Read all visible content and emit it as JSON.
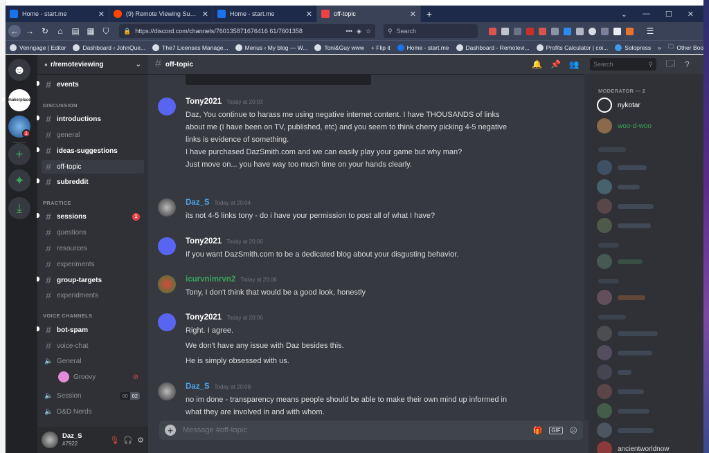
{
  "browser": {
    "tabs": [
      {
        "title": "Home - start.me",
        "favicon_color": "#1a73e8",
        "active": false
      },
      {
        "title": "(9) Remote Viewing Subreddit",
        "favicon_color": "#ff4500",
        "active": false
      },
      {
        "title": "Home - start.me",
        "favicon_color": "#1a73e8",
        "active": false
      },
      {
        "title": "off-topic",
        "favicon_color": "#ed4245",
        "active": true
      }
    ],
    "url": "https://discord.com/channels/760135871676416 61/7601358",
    "search_placeholder": "Search",
    "bookmarks": [
      "Venngage | Editor",
      "Dashboard ‹ JohnQue...",
      "The7 Licenses Manage...",
      "Menus ‹ My blog — W...",
      "Toni&Guy www",
      "+ Flip it",
      "Home - start.me",
      "Dashboard - Remotevi...",
      "Profits Calculator | coi...",
      "Solopress",
      "Other Bookmarks"
    ]
  },
  "server": {
    "name": "r/remoteviewing",
    "guild_badge": "1"
  },
  "categories": {
    "discussion": "DISCUSSION",
    "practice": "PRACTICE",
    "voice": "VOICE CHANNELS"
  },
  "channels": {
    "events": "events",
    "introductions": "introductions",
    "general": "general",
    "ideas": "ideas-suggestions",
    "offtopic": "off-topic",
    "subreddit": "subreddit",
    "sessions": "sessions",
    "sessions_badge": "1",
    "questions": "questions",
    "resources": "resources",
    "experiments": "experiments",
    "group_targets": "group-targets",
    "experidments": "experidments",
    "bot_spam": "bot-spam",
    "voice_chat": "voice-chat",
    "voice_general": "General",
    "groovy": "Groovy",
    "session": "Session",
    "session_count": "00",
    "session_limit": "02",
    "dnd": "D&D Nerds"
  },
  "user": {
    "name": "Daz_S",
    "tag": "#7922"
  },
  "header": {
    "channel": "off-topic",
    "search_placeholder": "Search"
  },
  "messages": [
    {
      "author": "Tony2021",
      "color": "#ffffff",
      "time": "Today at 20:03",
      "lines": [
        "Daz,  You continue to harass me using negative internet content. I have THOUSANDS of links",
        "about me (I have been on TV, published, etc) and you seem to think cherry picking 4-5 negative",
        "links is evidence of something.",
        "",
        "I have purchased DazSmith.com and we can easily play your game but why man?",
        "Just move on... you have way too much time on your hands clearly."
      ]
    },
    {
      "author": "Daz_S",
      "color": "#4ca6ec",
      "time": "Today at 20:04",
      "lines": [
        "its not 4-5 links tony - do i have your permission to post all of what I have?"
      ]
    },
    {
      "author": "Tony2021",
      "color": "#ffffff",
      "time": "Today at 20:06",
      "lines": [
        "If you want DazSmith.com to be a dedicated blog about your disgusting behavior."
      ]
    },
    {
      "author": "icurvnimrvn2",
      "color": "#3ba55d",
      "time": "Today at 20:06",
      "lines": [
        "Tony, I don't think that would be a good look, honestly"
      ]
    },
    {
      "author": "Tony2021",
      "color": "#ffffff",
      "time": "Today at 20:06",
      "lines": [
        "Right. I agree.",
        "We don't have any issue with Daz besides this.",
        "He is simply obsessed with us."
      ]
    },
    {
      "author": "Daz_S",
      "color": "#4ca6ec",
      "time": "Today at 20:08",
      "lines": [
        "no im done - transparency means people should be able to make their own mind up informed in",
        "what they are involved in and with whom."
      ]
    }
  ],
  "composer": {
    "placeholder": "Message #off-topic"
  },
  "members": {
    "moderator_header": "MODERATOR — 2",
    "moderators": [
      {
        "name": "nykotar",
        "color": "#ffffff"
      },
      {
        "name": "woo-d-woo",
        "color": "#3ba55d"
      }
    ],
    "last_visible": "ancientworldnow"
  }
}
